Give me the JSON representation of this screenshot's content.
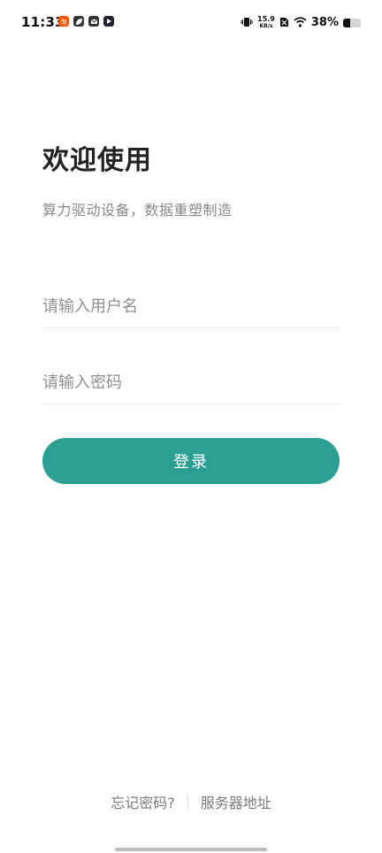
{
  "status_bar": {
    "time": "11:33",
    "net_speed_value": "15.9",
    "net_speed_unit": "KB/s",
    "battery_percent": "38%",
    "battery_level": 0.38,
    "icons": [
      "taobao-icon",
      "leaf-icon",
      "mail-icon",
      "play-icon",
      "vibrate-icon",
      "no-sim-icon",
      "wifi-icon",
      "battery-icon"
    ]
  },
  "main": {
    "title": "欢迎使用",
    "subtitle": "算力驱动设备，数据重塑制造"
  },
  "form": {
    "username_placeholder": "请输入用户名",
    "username_value": "",
    "password_placeholder": "请输入密码",
    "password_value": "",
    "login_label": "登录"
  },
  "footer": {
    "forgot_password": "忘记密码?",
    "server_address": "服务器地址"
  },
  "colors": {
    "accent": "#2ba092",
    "title_text": "#222222",
    "muted_text": "#8a8a8a"
  }
}
